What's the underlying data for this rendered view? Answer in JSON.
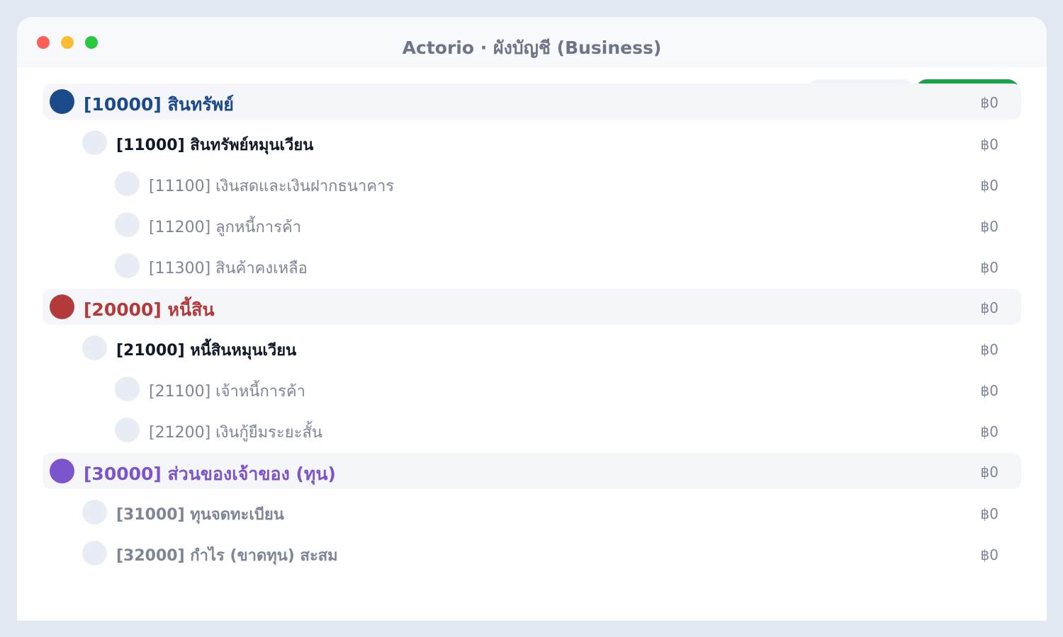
{
  "window": {
    "title": "Actorio · ผังบัญชี (Business)",
    "controls": [
      "close",
      "minimize",
      "maximize"
    ],
    "control_colors": {
      "close": "#ff5f57",
      "minimize": "#febc2e",
      "maximize": "#28c840"
    }
  },
  "toolbar": {
    "primary_button_color": "#1aa34a"
  },
  "accounts": [
    {
      "level": "group",
      "label": "[10000] สินทรัพย์",
      "amount": "฿0",
      "color": "#1a4a8a",
      "dot_color": "#1a4a8a"
    },
    {
      "level": "level1",
      "label": "[11000] สินทรัพย์หมุนเวียน",
      "amount": "฿0",
      "color": "#111827",
      "dot_color": "#e8ecf4"
    },
    {
      "level": "level2",
      "label": "[11100] เงินสดและเงินฝากธนาคาร",
      "amount": "฿0",
      "color": "#7d8597",
      "dot_color": "#e8ecf4"
    },
    {
      "level": "level2",
      "label": "[11200] ลูกหนี้การค้า",
      "amount": "฿0",
      "color": "#7d8597",
      "dot_color": "#e8ecf4"
    },
    {
      "level": "level2",
      "label": "[11300] สินค้าคงเหลือ",
      "amount": "฿0",
      "color": "#7d8597",
      "dot_color": "#e8ecf4"
    },
    {
      "level": "group",
      "label": "[20000] หนี้สิน",
      "amount": "฿0",
      "color": "#b23a3a",
      "dot_color": "#b23a3a"
    },
    {
      "level": "level1",
      "label": "[21000] หนี้สินหมุนเวียน",
      "amount": "฿0",
      "color": "#111827",
      "dot_color": "#e8ecf4"
    },
    {
      "level": "level2",
      "label": "[21100] เจ้าหนี้การค้า",
      "amount": "฿0",
      "color": "#7d8597",
      "dot_color": "#e8ecf4"
    },
    {
      "level": "level2",
      "label": "[21200] เงินกู้ยืมระยะสั้น",
      "amount": "฿0",
      "color": "#7d8597",
      "dot_color": "#e8ecf4"
    },
    {
      "level": "group",
      "label": "[30000] ส่วนของเจ้าของ (ทุน)",
      "amount": "฿0",
      "color": "#7c55cc",
      "dot_color": "#7c55cc"
    },
    {
      "level": "level1",
      "label": "[31000] ทุนจดทะเบียน",
      "amount": "฿0",
      "color": "#7d8597",
      "dot_color": "#e8ecf4"
    },
    {
      "level": "level1",
      "label": "[32000] กำไร (ขาดทุน) สะสม",
      "amount": "฿0",
      "color": "#7d8597",
      "dot_color": "#e8ecf4"
    }
  ]
}
